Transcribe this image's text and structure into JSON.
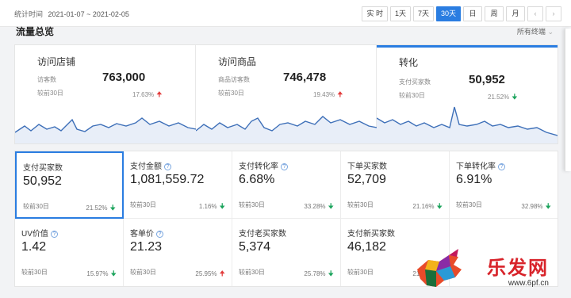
{
  "header": {
    "stat_time_label": "统计时间",
    "date_range": "2021-01-07 ~ 2021-02-05",
    "ranges": [
      "实 时",
      "1天",
      "7天",
      "30天",
      "日",
      "周",
      "月"
    ],
    "active_range": "30天",
    "prev_icon": "chevron-left-icon",
    "next_icon": "chevron-right-icon"
  },
  "section": {
    "title": "流量总览",
    "select_label": "所有终端"
  },
  "summary": [
    {
      "title": "访问店铺",
      "sub_label": "访客数",
      "value": "763,000",
      "compare_label": "较前30日",
      "change": "17.63%",
      "trend": "up",
      "active": false
    },
    {
      "title": "访问商品",
      "sub_label": "商品访客数",
      "value": "746,478",
      "compare_label": "较前30日",
      "change": "19.43%",
      "trend": "up",
      "active": false
    },
    {
      "title": "转化",
      "sub_label": "支付买家数",
      "value": "50,952",
      "compare_label": "较前30日",
      "change": "21.52%",
      "trend": "down",
      "active": true
    }
  ],
  "metrics": [
    {
      "label": "支付买家数",
      "value": "50,952",
      "compare_label": "较前30日",
      "change": "21.52%",
      "trend": "down",
      "help": false,
      "selected": true
    },
    {
      "label": "支付金额",
      "value": "1,081,559.72",
      "compare_label": "较前30日",
      "change": "1.16%",
      "trend": "down",
      "help": true,
      "selected": false
    },
    {
      "label": "支付转化率",
      "value": "6.68%",
      "compare_label": "较前30日",
      "change": "33.28%",
      "trend": "down",
      "help": true,
      "selected": false
    },
    {
      "label": "下单买家数",
      "value": "52,709",
      "compare_label": "较前30日",
      "change": "21.16%",
      "trend": "down",
      "help": false,
      "selected": false
    },
    {
      "label": "下单转化率",
      "value": "6.91%",
      "compare_label": "较前30日",
      "change": "32.98%",
      "trend": "down",
      "help": true,
      "selected": false
    },
    {
      "label": "UV价值",
      "value": "1.42",
      "compare_label": "较前30日",
      "change": "15.97%",
      "trend": "down",
      "help": true,
      "selected": false
    },
    {
      "label": "客单价",
      "value": "21.23",
      "compare_label": "较前30日",
      "change": "25.95%",
      "trend": "up",
      "help": true,
      "selected": false
    },
    {
      "label": "支付老买家数",
      "value": "5,374",
      "compare_label": "较前30日",
      "change": "25.78%",
      "trend": "down",
      "help": false,
      "selected": false
    },
    {
      "label": "支付新买家数",
      "value": "46,182",
      "compare_label": "较前30日",
      "change": "21.05%",
      "trend": "down",
      "help": false,
      "selected": false
    }
  ],
  "watermark": {
    "brand": "乐发网",
    "url": "www.6pf.cn",
    "logo": "bull-logo-icon"
  },
  "colors": {
    "accent": "#2a7de1",
    "up": "#e23b3b",
    "down": "#1aa35b",
    "spark_line": "#3d6fb8",
    "spark_fill": "#e8eef8"
  },
  "trend_icons": {
    "up": "arrow-up-icon",
    "down": "arrow-down-icon"
  }
}
